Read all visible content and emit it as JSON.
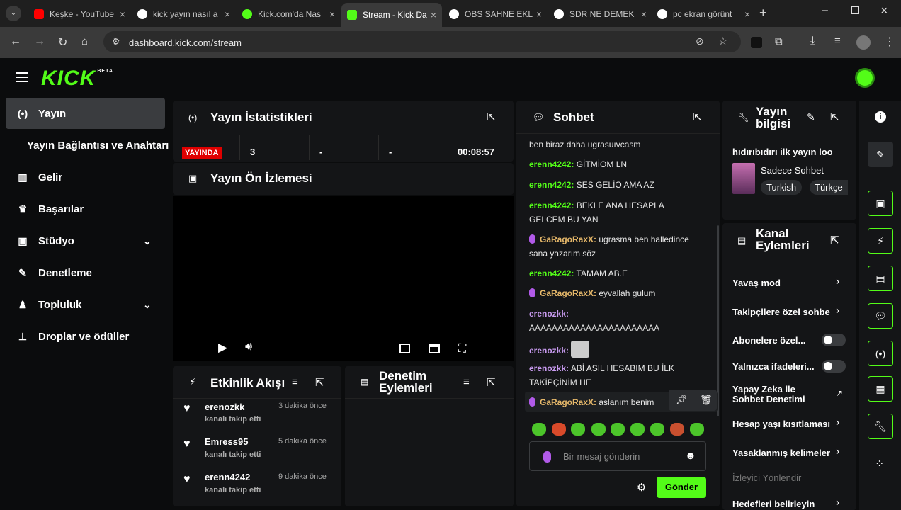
{
  "browser": {
    "tabs": [
      {
        "label": "Keşke - YouTube",
        "color": "#ff0000"
      },
      {
        "label": "kick yayın nasıl a",
        "color": "#4285f4"
      },
      {
        "label": "Kick.com'da Nas",
        "color": "#53fc18"
      },
      {
        "label": "Stream - Kick Da",
        "color": "#53fc18"
      },
      {
        "label": "OBS SAHNE EKL",
        "color": "#4285f4"
      },
      {
        "label": "SDR NE DEMEK",
        "color": "#4285f4"
      },
      {
        "label": "pc ekran görünt",
        "color": "#4285f4"
      }
    ],
    "url": "dashboard.kick.com/stream"
  },
  "app": {
    "logo": "KICK",
    "beta": "BETA"
  },
  "sidebar": {
    "items": [
      {
        "label": "Yayın",
        "icon": "broadcast-icon"
      },
      {
        "label": "Yayın Bağlantısı ve Anahtarı"
      },
      {
        "label": "Gelir",
        "icon": "chart-icon"
      },
      {
        "label": "Başarılar",
        "icon": "trophy-icon"
      },
      {
        "label": "Stüdyo",
        "icon": "studio-icon"
      },
      {
        "label": "Denetleme",
        "icon": "wrench-icon"
      },
      {
        "label": "Topluluk",
        "icon": "people-icon"
      },
      {
        "label": "Droplar ve ödüller",
        "icon": "drops-icon"
      }
    ]
  },
  "stats": {
    "title": "Yayın İstatistikleri",
    "live": "YAYINDA",
    "viewers": "3",
    "c2": "-",
    "c3": "-",
    "time": "00:08:57"
  },
  "preview": {
    "title": "Yayın Ön İzlemesi"
  },
  "activity": {
    "title": "Etkinlik Akışı",
    "items": [
      {
        "name": "erenozkk",
        "sub": "kanalı takip etti",
        "time": "3 dakika önce"
      },
      {
        "name": "Emress95",
        "sub": "kanalı takip etti",
        "time": "5 dakika önce"
      },
      {
        "name": "erenn4242",
        "sub": "kanalı takip etti",
        "time": "9 dakika önce"
      }
    ]
  },
  "modactions": {
    "title": "Denetim Eylemleri"
  },
  "chat": {
    "title": "Sohbet",
    "messages": [
      {
        "user": "",
        "text": "ben biraz daha ugrasuıvcasm"
      },
      {
        "user": "erenn4242:",
        "text": "GİTMİOM LN"
      },
      {
        "user": "erenn4242:",
        "text": "SES GELİO AMA AZ"
      },
      {
        "user": "erenn4242:",
        "text": "BEKLE ANA HESAPLA GELCEM BU YAN"
      },
      {
        "user": "GaRagoRaxX:",
        "text": "ugrasma ben halledince sana yazarım söz"
      },
      {
        "user": "erenn4242:",
        "text": "TAMAM AB.E"
      },
      {
        "user": "GaRagoRaxX:",
        "text": "eyvallah gulum"
      },
      {
        "user": "erenozkk:",
        "text": "AAAAAAAAAAAAAAAAAAAAAAA"
      },
      {
        "user": "erenozkk:",
        "text": ""
      },
      {
        "user": "erenozkk:",
        "text": "ABİ ASIL HESABIM BU İLK TAKİPÇİNİM HE"
      },
      {
        "user": "GaRagoRaxX:",
        "text": "aslanım benim"
      }
    ],
    "placeholder": "Bir mesaj gönderin",
    "send": "Gönder"
  },
  "info": {
    "title": "Yayın bilgisi",
    "stream_title": "hıdırıbıdırı ilk yayın loo",
    "category": "Sadece Sohbet",
    "tags": [
      "Turkish",
      "Türkçe"
    ]
  },
  "channel": {
    "title": "Kanal Eylemleri",
    "actions": [
      {
        "label": "Yavaş mod",
        "control": "chevron"
      },
      {
        "label": "Takipçilere özel sohbe",
        "control": "chevron"
      },
      {
        "label": "Abonelere özel...",
        "control": "toggle"
      },
      {
        "label": "Yalnızca ifadeleri...",
        "control": "toggle"
      },
      {
        "label": "Yapay Zeka ile Sohbet Denetimi",
        "control": "external"
      },
      {
        "label": "Hesap yaşı kısıtlaması",
        "control": "chevron"
      },
      {
        "label": "Yasaklanmış kelimeler",
        "control": "chevron"
      },
      {
        "label": "İzleyici Yönlendir",
        "control": "none"
      },
      {
        "label": "Hedefleri belirleyin",
        "control": "chevron"
      }
    ]
  },
  "colors": {
    "accent": "#53fc18",
    "live": "#e00000"
  }
}
